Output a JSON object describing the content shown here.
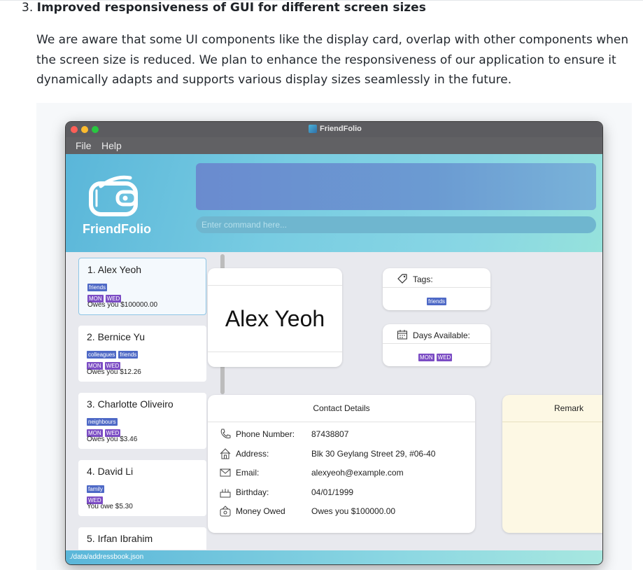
{
  "section": {
    "number": "3.",
    "heading": "Improved responsiveness of GUI for different screen sizes",
    "paragraph": "We are aware that some UI components like the display card, overlap with other components when the screen size is reduced. We plan to enhance the responsiveness of our application to ensure it dynamically adapts and supports various display sizes seamlessly in the future."
  },
  "app": {
    "window_title": "FriendFolio",
    "menu": {
      "file": "File",
      "help": "Help"
    },
    "logo_text": "FriendFolio",
    "command_placeholder": "Enter command here...",
    "status_bar": "./data/addressbook.json",
    "contacts": [
      {
        "name": "1. Alex Yeoh",
        "tags": [
          "friends"
        ],
        "days": [
          "MON",
          "WED"
        ],
        "owe": "Owes you $100000.00"
      },
      {
        "name": "2. Bernice Yu",
        "tags": [
          "colleagues",
          "friends"
        ],
        "days": [
          "MON",
          "WED"
        ],
        "owe": "Owes you $12.26"
      },
      {
        "name": "3. Charlotte Oliveiro",
        "tags": [
          "neighbours"
        ],
        "days": [
          "MON",
          "WED"
        ],
        "owe": "Owes you $3.46"
      },
      {
        "name": "4. David Li",
        "tags": [
          "family"
        ],
        "days": [
          "WED"
        ],
        "owe": "You owe $5.30"
      },
      {
        "name": "5. Irfan Ibrahim",
        "tags": [],
        "days": [],
        "owe": ""
      }
    ],
    "detail": {
      "name": "Alex Yeoh",
      "tags_title": "Tags:",
      "tags": [
        "friends"
      ],
      "days_title": "Days Available:",
      "days": [
        "MON",
        "WED"
      ],
      "contact_title": "Contact Details",
      "remark_title": "Remark",
      "fields": [
        {
          "icon": "phone-icon",
          "label": "Phone Number:",
          "value": "87438807"
        },
        {
          "icon": "home-icon",
          "label": "Address:",
          "value": "Blk 30 Geylang Street 29, #06-40"
        },
        {
          "icon": "mail-icon",
          "label": "Email:",
          "value": "alexyeoh@example.com"
        },
        {
          "icon": "cake-icon",
          "label": "Birthday:",
          "value": "04/01/1999"
        },
        {
          "icon": "money-icon",
          "label": "Money Owed",
          "value": "Owes you $100000.00"
        }
      ]
    },
    "colors": {
      "tag_blue": "#4e69c6",
      "day_purple": "#7b4cc4",
      "remark_bg": "#fdf8e4"
    }
  }
}
